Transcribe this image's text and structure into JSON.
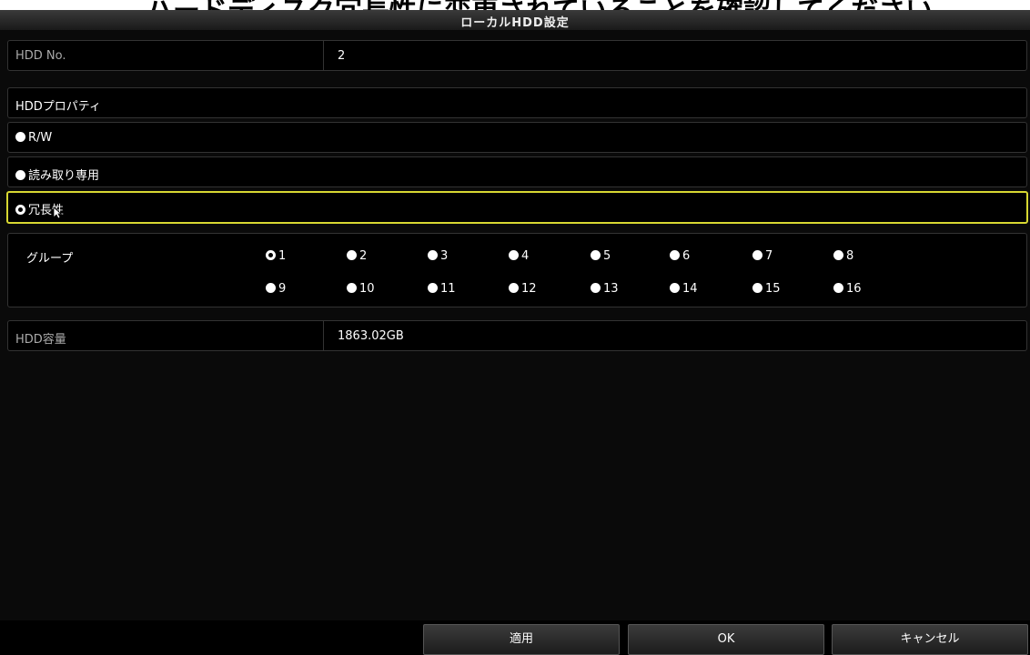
{
  "top_banner": {
    "text_before": "ハードディスク",
    "text_underlined": "冗長性",
    "text_after": "に変更されていることを確認してください。"
  },
  "window": {
    "title": "ローカルHDD設定"
  },
  "fields": {
    "hdd_no": {
      "label": "HDD No.",
      "value": "2"
    },
    "hdd_property": {
      "label": "HDDプロパティ"
    },
    "hdd_capacity": {
      "label": "HDD容量",
      "value": "1863.02GB"
    }
  },
  "property_options": [
    {
      "label": "R/W",
      "selected": false
    },
    {
      "label": "読み取り専用",
      "selected": false
    },
    {
      "label": "冗長性",
      "selected": true
    }
  ],
  "group": {
    "label": "グループ",
    "selected": "1",
    "options": [
      "1",
      "2",
      "3",
      "4",
      "5",
      "6",
      "7",
      "8",
      "9",
      "10",
      "11",
      "12",
      "13",
      "14",
      "15",
      "16"
    ]
  },
  "buttons": {
    "apply": "適用",
    "ok": "OK",
    "cancel": "キャンセル"
  },
  "colors": {
    "selection_border": "#d8d832",
    "background": "#000000"
  }
}
